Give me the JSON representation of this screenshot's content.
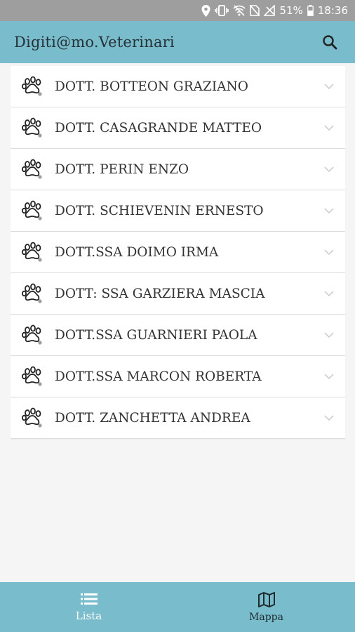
{
  "status_bar": {
    "battery": "51%",
    "time": "18:36",
    "icons": [
      "location-icon",
      "vibrate-icon",
      "wifi-off-icon",
      "no-sim-icon",
      "signal-off-icon",
      "battery-icon"
    ]
  },
  "header": {
    "title": "Digiti@mo.Veterinari",
    "search_icon": "search-icon"
  },
  "list": {
    "item_icon": "paw-icon",
    "items": [
      {
        "name": "DOTT. BOTTEON GRAZIANO"
      },
      {
        "name": "DOTT. CASAGRANDE MATTEO"
      },
      {
        "name": "DOTT. PERIN ENZO"
      },
      {
        "name": "DOTT. SCHIEVENIN ERNESTO"
      },
      {
        "name": "DOTT.SSA DOIMO IRMA"
      },
      {
        "name": "DOTT: SSA GARZIERA MASCIA"
      },
      {
        "name": "DOTT.SSA GUARNIERI PAOLA"
      },
      {
        "name": "DOTT.SSA MARCON ROBERTA"
      },
      {
        "name": "DOTT. ZANCHETTA ANDREA"
      }
    ]
  },
  "bottom_nav": {
    "tabs": [
      {
        "label": "Lista",
        "icon": "list-icon",
        "active": true
      },
      {
        "label": "Mappa",
        "icon": "map-icon",
        "active": false
      }
    ]
  },
  "colors": {
    "header_bg": "#79bccb",
    "status_bg": "#9e9e9e",
    "page_bg": "#f5f5f5"
  }
}
